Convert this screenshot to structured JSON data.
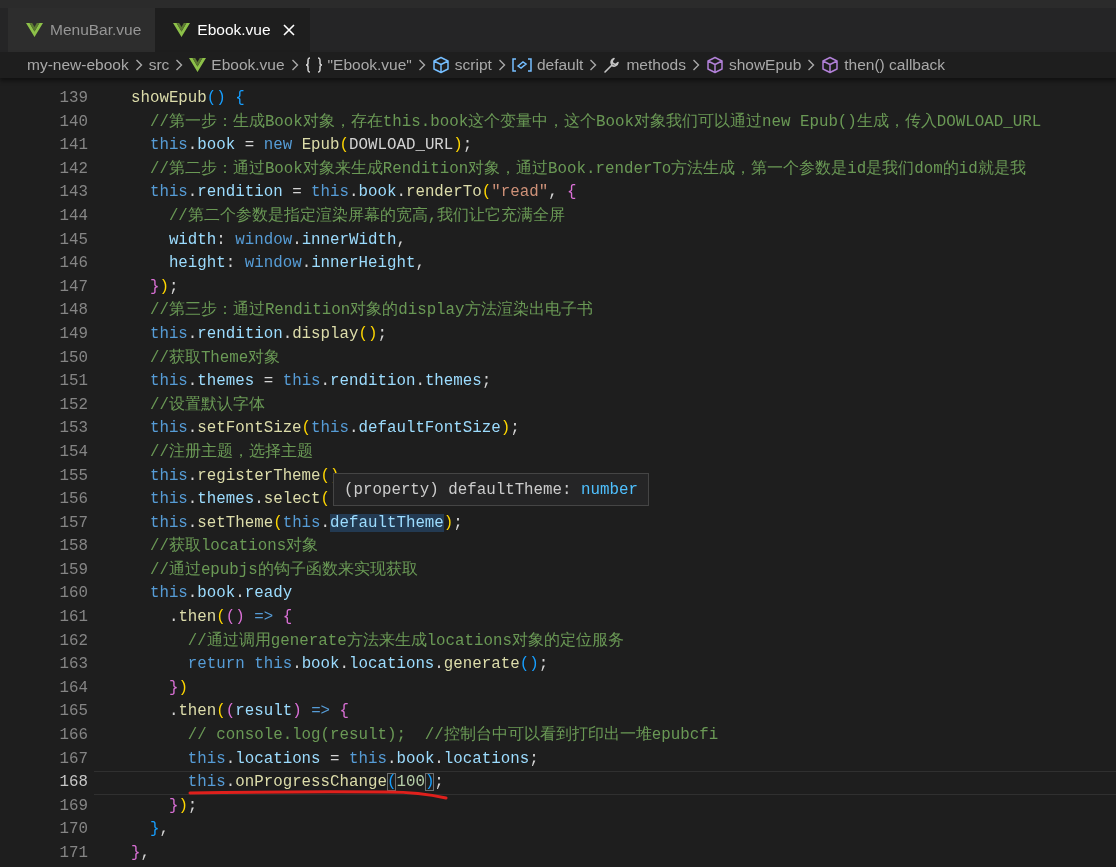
{
  "tabs": [
    {
      "label": "MenuBar.vue",
      "selected": false
    },
    {
      "label": "Ebook.vue",
      "selected": true
    }
  ],
  "breadcrumb": [
    {
      "label": "my-new-ebook"
    },
    {
      "label": "src"
    },
    {
      "label": "Ebook.vue",
      "kind": "vue"
    },
    {
      "label": "\"Ebook.vue\"",
      "kind": "braces"
    },
    {
      "label": "script",
      "kind": "box"
    },
    {
      "label": "default",
      "kind": "module"
    },
    {
      "label": "methods",
      "kind": "wrench"
    },
    {
      "label": "showEpub",
      "kind": "cube"
    },
    {
      "label": "then() callback",
      "kind": "cube"
    }
  ],
  "lines": [
    {
      "number": "139",
      "current": false,
      "text": "  showEpub() {"
    },
    {
      "number": "140",
      "current": false,
      "text": "    //第一步：生成Book对象，存在this.book这个变量中，这个Book对象我们可以通过new Epub()生成，传入DOWLOAD_URL"
    },
    {
      "number": "141",
      "current": false,
      "text": "    this.book = new Epub(DOWLOAD_URL);"
    },
    {
      "number": "142",
      "current": false,
      "text": "    //第二步：通过Book对象来生成Rendition对象，通过Book.renderTo方法生成，第一个参数是id是我们dom的id就是我"
    },
    {
      "number": "143",
      "current": false,
      "text": "    this.rendition = this.book.renderTo(\"read\", {"
    },
    {
      "number": "144",
      "current": false,
      "text": "      //第二个参数是指定渲染屏幕的宽高,我们让它充满全屏"
    },
    {
      "number": "145",
      "current": false,
      "text": "      width: window.innerWidth,"
    },
    {
      "number": "146",
      "current": false,
      "text": "      height: window.innerHeight,"
    },
    {
      "number": "147",
      "current": false,
      "text": "    });"
    },
    {
      "number": "148",
      "current": false,
      "text": "    //第三步：通过Rendition对象的display方法渲染出电子书"
    },
    {
      "number": "149",
      "current": false,
      "text": "    this.rendition.display();"
    },
    {
      "number": "150",
      "current": false,
      "text": "    //获取Theme对象"
    },
    {
      "number": "151",
      "current": false,
      "text": "    this.themes = this.rendition.themes;"
    },
    {
      "number": "152",
      "current": false,
      "text": "    //设置默认字体"
    },
    {
      "number": "153",
      "current": false,
      "text": "    this.setFontSize(this.defaultFontSize);"
    },
    {
      "number": "154",
      "current": false,
      "text": "    //注册主题，选择主题"
    },
    {
      "number": "155",
      "current": false,
      "text": "    this.registerTheme()"
    },
    {
      "number": "156",
      "current": false,
      "text": "    this.themes.select("
    },
    {
      "number": "157",
      "current": false,
      "text": "    this.setTheme(this.",
      "hovered": "defaultTheme",
      "text_after": ");"
    },
    {
      "number": "158",
      "current": false,
      "text": "    //获取locations对象"
    },
    {
      "number": "159",
      "current": false,
      "text": "    //通过epubjs的钩子函数来实现获取"
    },
    {
      "number": "160",
      "current": false,
      "text": "    this.book.ready"
    },
    {
      "number": "161",
      "current": false,
      "text": "      .then(() => {"
    },
    {
      "number": "162",
      "current": false,
      "text": "        //通过调用generate方法来生成locations对象的定位服务"
    },
    {
      "number": "163",
      "current": false,
      "text": "        return this.book.locations.generate();"
    },
    {
      "number": "164",
      "current": false,
      "text": "      })"
    },
    {
      "number": "165",
      "current": false,
      "text": "      .then((result) => {"
    },
    {
      "number": "166",
      "current": false,
      "text": "        // console.log(result);  //控制台中可以看到打印出一堆epubcfi"
    },
    {
      "number": "167",
      "current": false,
      "text": "        this.locations = this.book.locations;"
    },
    {
      "number": "168",
      "current": true,
      "text": "        this.onProgressChange(100);"
    },
    {
      "number": "169",
      "current": false,
      "text": "      });"
    },
    {
      "number": "170",
      "current": false,
      "text": "    },"
    },
    {
      "number": "171",
      "current": false,
      "text": "  },"
    }
  ],
  "hover": {
    "text": "(property) defaultTheme: ",
    "type": "number"
  }
}
